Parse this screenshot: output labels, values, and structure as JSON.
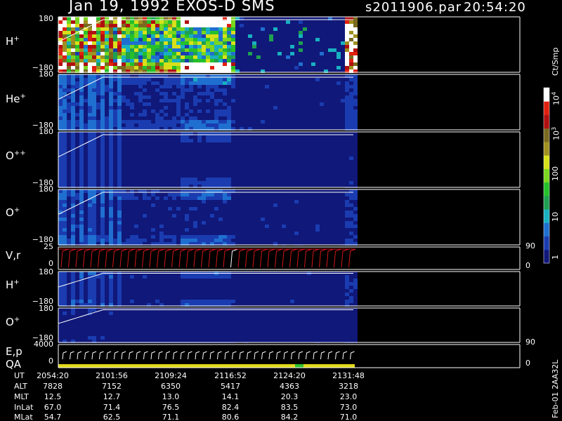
{
  "header": {
    "title": "Jan 19, 1992   EXOS-D SMS",
    "file": "s2011906.par",
    "time": "20:54:20"
  },
  "colorbar": {
    "unit": "Ct/Smp",
    "tick_labels": [
      "1",
      "10",
      "100",
      "10",
      "10"
    ],
    "tick_exponents": [
      "",
      "",
      "",
      "3",
      "4"
    ],
    "colors": [
      "#10187a",
      "#1a3cb0",
      "#1f6fd0",
      "#19b0c0",
      "#1ea050",
      "#25c02a",
      "#7ad61e",
      "#d8e01a",
      "#a09020",
      "#7a6a20",
      "#b01010",
      "#e02010",
      "#ffffff"
    ]
  },
  "panels": [
    {
      "label": "H",
      "sup": "+",
      "ticks": [
        "180",
        "−180"
      ],
      "right_ticks": []
    },
    {
      "label": "He",
      "sup": "+",
      "ticks": [
        "180",
        "−180"
      ],
      "right_ticks": []
    },
    {
      "label": "O",
      "sup": "++",
      "ticks": [
        "180",
        "−180"
      ],
      "right_ticks": []
    },
    {
      "label": "O",
      "sup": "+",
      "ticks": [
        "180",
        "−180"
      ],
      "right_ticks": []
    },
    {
      "label": "V,r",
      "sup": "",
      "ticks": [
        "25",
        "0"
      ],
      "right_ticks": [
        "90",
        "0"
      ]
    },
    {
      "label": "H",
      "sup": "+",
      "ticks": [
        "180",
        "−180"
      ],
      "right_ticks": []
    },
    {
      "label": "O",
      "sup": "+",
      "ticks": [
        "180",
        "−180"
      ],
      "right_ticks": []
    },
    {
      "label": "E,p",
      "sup": "",
      "ticks": [
        "4000",
        "0"
      ],
      "right_ticks": [
        "90",
        "0"
      ],
      "label2": "QA"
    }
  ],
  "side_note": "Feb-01 2AA32L",
  "chart_data": {
    "type": "heatmap",
    "title": "Jan 19, 1992   EXOS-D SMS",
    "xlabel": "UT",
    "x_ticks": [
      "2054:20",
      "2101:56",
      "2109:24",
      "2116:52",
      "2124:20",
      "2131:48"
    ],
    "ylim": [
      -180,
      180
    ],
    "series": [
      {
        "name": "H+",
        "ylim": [
          -180,
          180
        ]
      },
      {
        "name": "He+",
        "ylim": [
          -180,
          180
        ]
      },
      {
        "name": "O++",
        "ylim": [
          -180,
          180
        ]
      },
      {
        "name": "O+",
        "ylim": [
          -180,
          180
        ]
      },
      {
        "name": "V,r",
        "ylim": [
          0,
          25
        ]
      },
      {
        "name": "H+",
        "ylim": [
          -180,
          180
        ]
      },
      {
        "name": "O+",
        "ylim": [
          -180,
          180
        ]
      },
      {
        "name": "E,p",
        "ylim": [
          0,
          4000
        ]
      }
    ],
    "colorbar_unit": "Ct/Smp",
    "colorbar_ticks": [
      1,
      10,
      100,
      1000,
      10000
    ],
    "orbit_table": {
      "rows": [
        {
          "label": "UT",
          "values": [
            "2054:20",
            "2101:56",
            "2109:24",
            "2116:52",
            "2124:20",
            "2131:48"
          ]
        },
        {
          "label": "ALT",
          "values": [
            "7828",
            "7152",
            "6350",
            "5417",
            "4363",
            "3218"
          ]
        },
        {
          "label": "MLT",
          "values": [
            "12.5",
            "12.7",
            "13.0",
            "14.1",
            "20.3",
            "23.0"
          ]
        },
        {
          "label": "InLat",
          "values": [
            "67.0",
            "71.4",
            "76.5",
            "82.4",
            "83.5",
            "73.0"
          ]
        },
        {
          "label": "MLat",
          "values": [
            "54.7",
            "62.5",
            "71.1",
            "80.6",
            "84.2",
            "71.0"
          ]
        }
      ]
    }
  }
}
